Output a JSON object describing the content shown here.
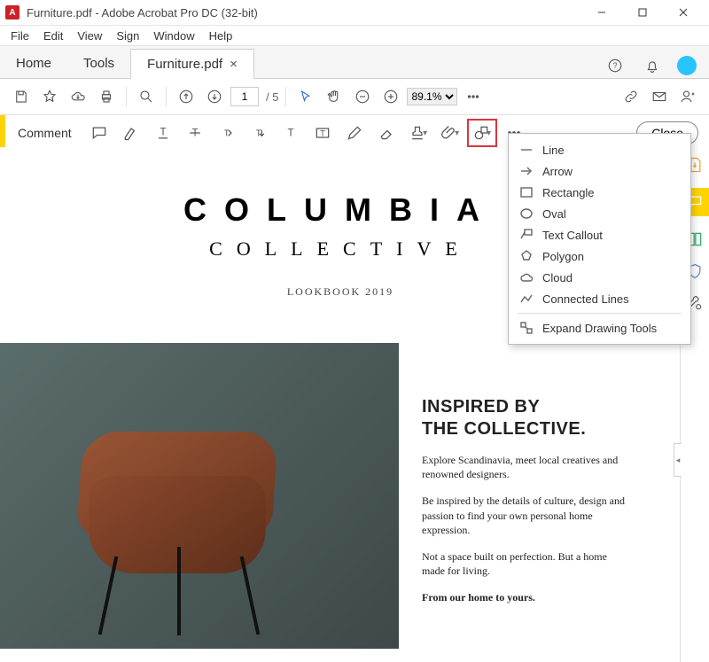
{
  "window": {
    "title": "Furniture.pdf - Adobe Acrobat Pro DC (32-bit)"
  },
  "menu": [
    "File",
    "Edit",
    "View",
    "Sign",
    "Window",
    "Help"
  ],
  "tabs": {
    "home": "Home",
    "tools": "Tools",
    "doc": "Furniture.pdf"
  },
  "toolbar1": {
    "page_current": "1",
    "page_total": "/ 5",
    "zoom": "89.1%"
  },
  "toolbar2": {
    "label": "Comment",
    "close": "Close"
  },
  "drawing_menu": {
    "line": "Line",
    "arrow": "Arrow",
    "rectangle": "Rectangle",
    "oval": "Oval",
    "callout": "Text Callout",
    "polygon": "Polygon",
    "cloud": "Cloud",
    "connected": "Connected Lines",
    "expand": "Expand Drawing Tools"
  },
  "doc": {
    "h1": "COLUMBIA",
    "h2": "COLLECTIVE",
    "h3": "LOOKBOOK 2019",
    "headline": "INSPIRED BY\nTHE COLLECTIVE.",
    "p1": "Explore Scandinavia, meet local creatives and renowned designers.",
    "p2": "Be inspired by the details of culture, design and passion to find your own personal home expression.",
    "p3": "Not a space built on perfection. But a home made for living.",
    "p4": "From our home to yours."
  }
}
